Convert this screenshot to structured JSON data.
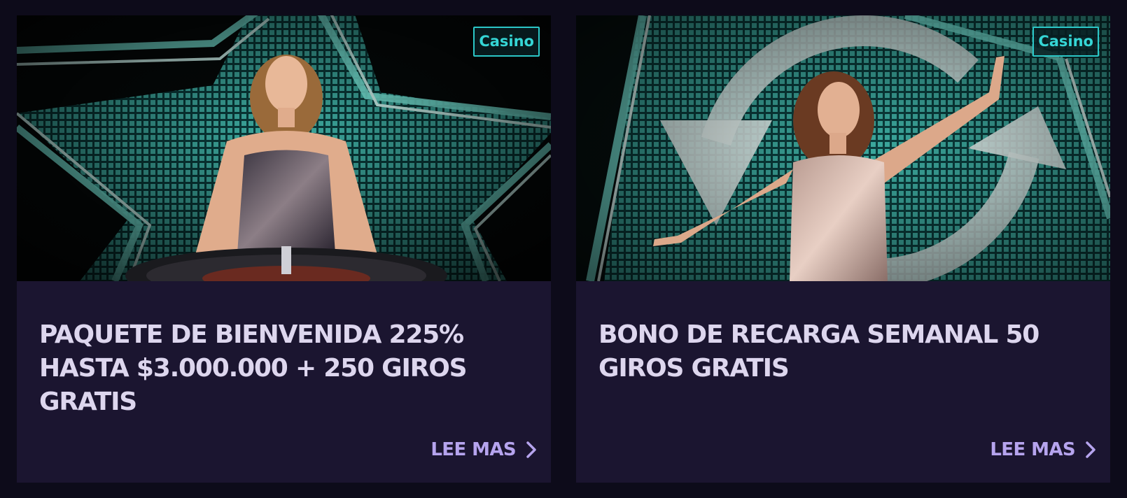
{
  "promotions": [
    {
      "tag": "Casino",
      "title": "PAQUETE DE BIENVENIDA 225% HASTA $3.000.000 + 250 GIROS GRATIS",
      "cta": "LEE MAS",
      "image_icon": "star-roulette-illustration"
    },
    {
      "tag": "Casino",
      "title": "BONO DE RECARGA SEMANAL 50 GIROS GRATIS",
      "cta": "LEE MAS",
      "image_icon": "reload-arrows-illustration"
    }
  ],
  "colors": {
    "page_background": "#0d0b1a",
    "card_background": "#1b1530",
    "title_text": "#ddd6ee",
    "cta_text": "#b6a4ee",
    "tag_accent": "#2bc7c7",
    "neon_teal": "#5ee8d6"
  },
  "icons": {
    "cta_arrow": "chevron-right-icon"
  }
}
